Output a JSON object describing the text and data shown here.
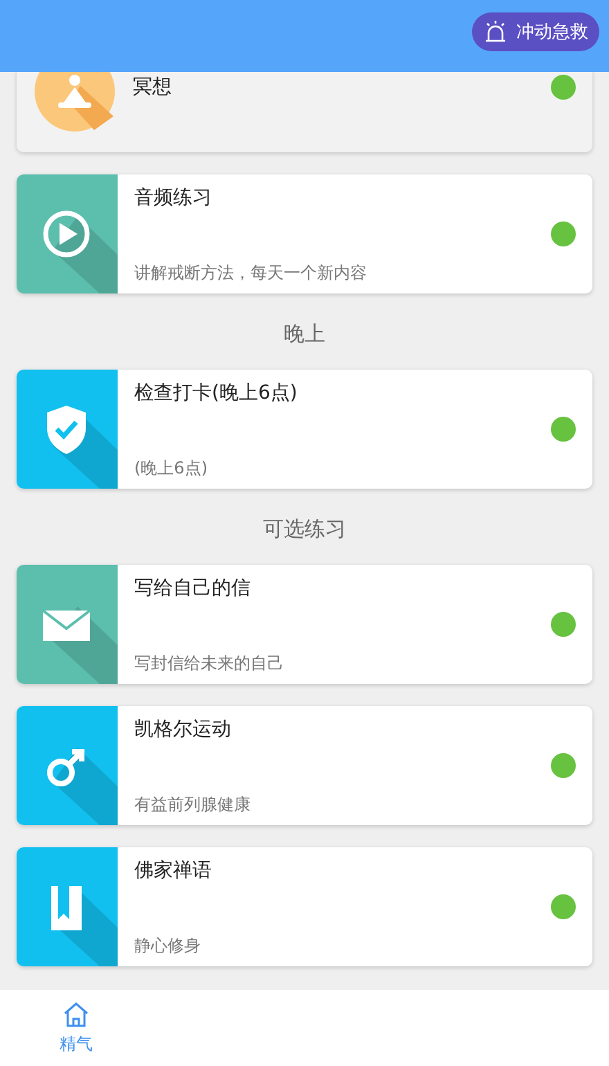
{
  "header": {
    "sos_button": "冲动急救"
  },
  "sections": [
    {
      "items": [
        {
          "kind": "meditation",
          "title": "冥想",
          "on": true
        }
      ]
    },
    {
      "items": [
        {
          "kind": "play",
          "color": "#5cbfad",
          "title": "音频练习",
          "subtitle": "讲解戒断方法，每天一个新内容",
          "on": true
        }
      ]
    },
    {
      "heading": "晚上",
      "items": [
        {
          "kind": "shield",
          "color": "#12c0ef",
          "title": "检查打卡(晚上6点)",
          "subtitle": "(晚上6点)",
          "on": true
        }
      ]
    },
    {
      "heading": "可选练习",
      "items": [
        {
          "kind": "mail",
          "color": "#5cbfad",
          "title": "写给自己的信",
          "subtitle": "写封信给未来的自己",
          "on": true
        },
        {
          "kind": "male",
          "color": "#12c0ef",
          "title": "凯格尔运动",
          "subtitle": "有益前列腺健康",
          "on": true
        },
        {
          "kind": "book",
          "color": "#12c0ef",
          "title": "佛家禅语",
          "subtitle": "静心修身",
          "on": true
        }
      ]
    }
  ],
  "tabs": [
    {
      "label": "精气",
      "selected": true
    }
  ]
}
